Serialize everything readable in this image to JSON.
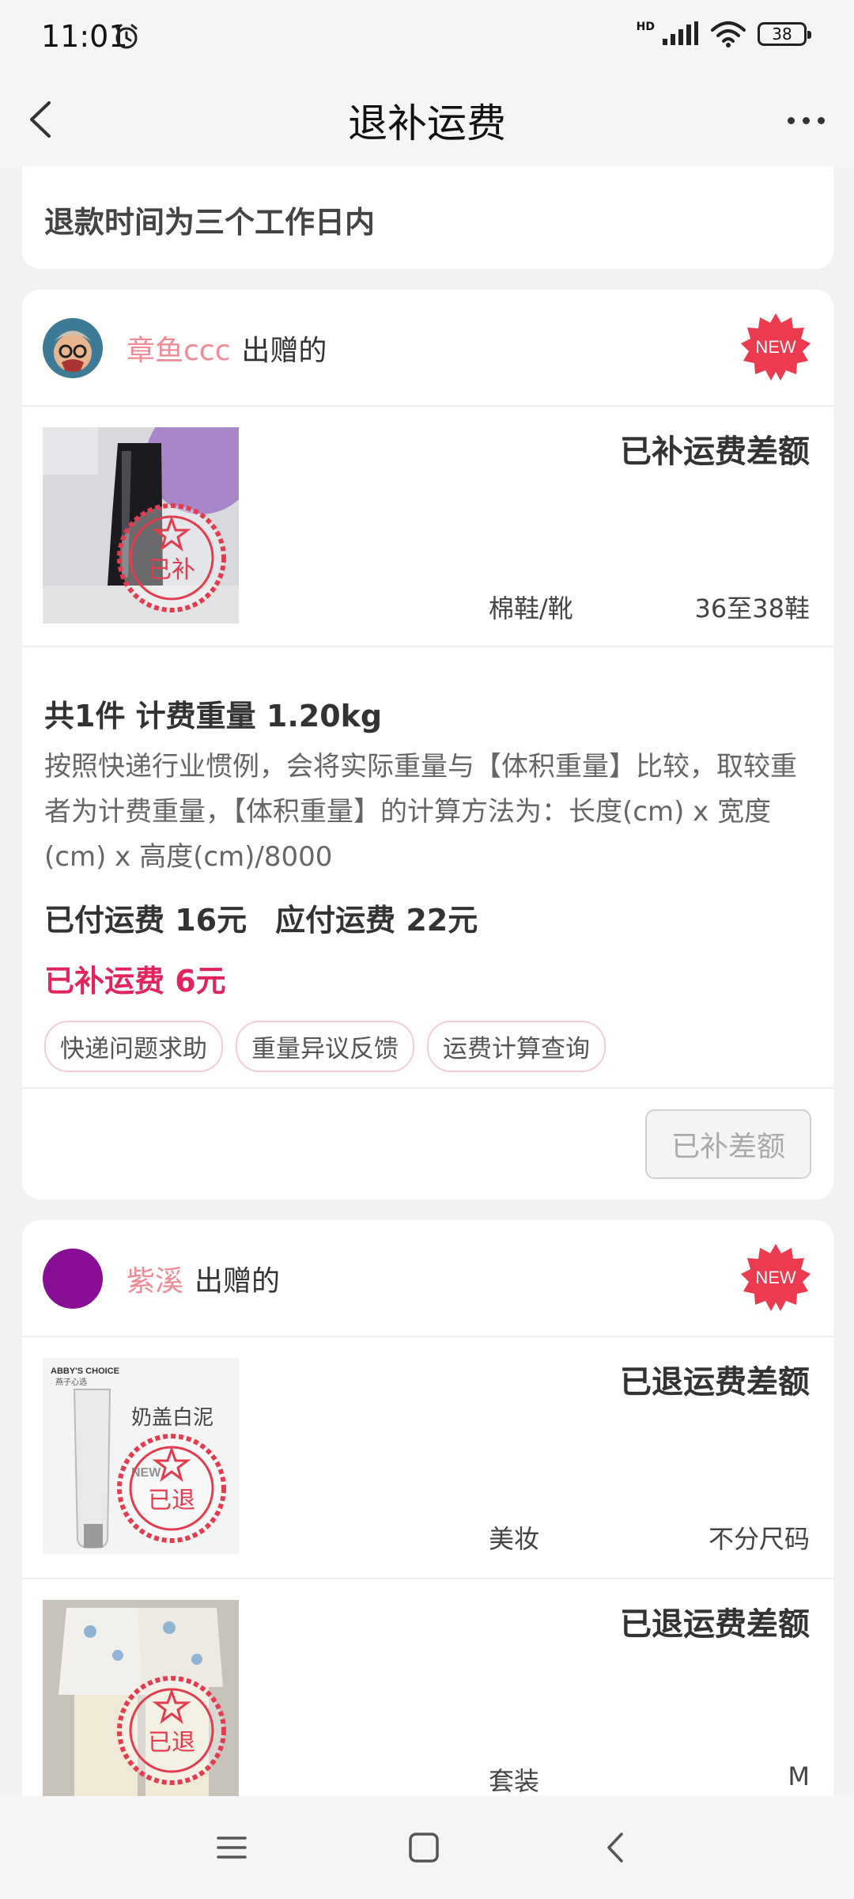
{
  "status_bar": {
    "time": "11:01",
    "network": "HD",
    "battery": "38",
    "icons": [
      "alarm-icon",
      "signal-icon",
      "wifi-icon",
      "battery-icon"
    ]
  },
  "nav": {
    "title": "退补运费",
    "back_icon": "back-arrow-icon",
    "more_icon": "more-icon"
  },
  "notice": {
    "text": "退款时间为三个工作日内"
  },
  "orders": [
    {
      "user_name": "章鱼ccc",
      "gift_text": "出赠的",
      "badge": "NEW",
      "items": [
        {
          "status": "已补运费差额",
          "stamp": "已补",
          "category": "棉鞋/靴",
          "size": "36至38鞋"
        }
      ],
      "summary": {
        "weight_line": "共1件 计费重量 1.20kg",
        "explain": "按照快递行业惯例，会将实际重量与【体积重量】比较，取较重者为计费重量，【体积重量】的计算方法为：长度(cm) x 宽度(cm) x 高度(cm)/8000",
        "paid": "已付运费 16元",
        "due": "应付运费 22元",
        "extra": "已补运费 6元",
        "chips": [
          "快递问题求助",
          "重量异议反馈",
          "运费计算查询"
        ],
        "action": "已补差额"
      }
    },
    {
      "user_name": "紫溪",
      "gift_text": "出赠的",
      "badge": "NEW",
      "items": [
        {
          "status": "已退运费差额",
          "stamp": "已退",
          "category": "美妆",
          "size": "不分尺码",
          "product_text": {
            "brand": "ABBY'S CHOICE",
            "brand_cn": "燕子心选",
            "name": "奶盖白泥",
            "badge": "NEW"
          }
        },
        {
          "status": "已退运费差额",
          "stamp": "已退",
          "category": "套装",
          "size": "M"
        }
      ]
    }
  ],
  "colors": {
    "accent_pink": "#f08a96",
    "accent_red": "#e0245e",
    "badge_red": "#ec3a4e"
  },
  "bottom_nav": {
    "icons": [
      "menu-icon",
      "home-icon",
      "back-icon"
    ]
  }
}
